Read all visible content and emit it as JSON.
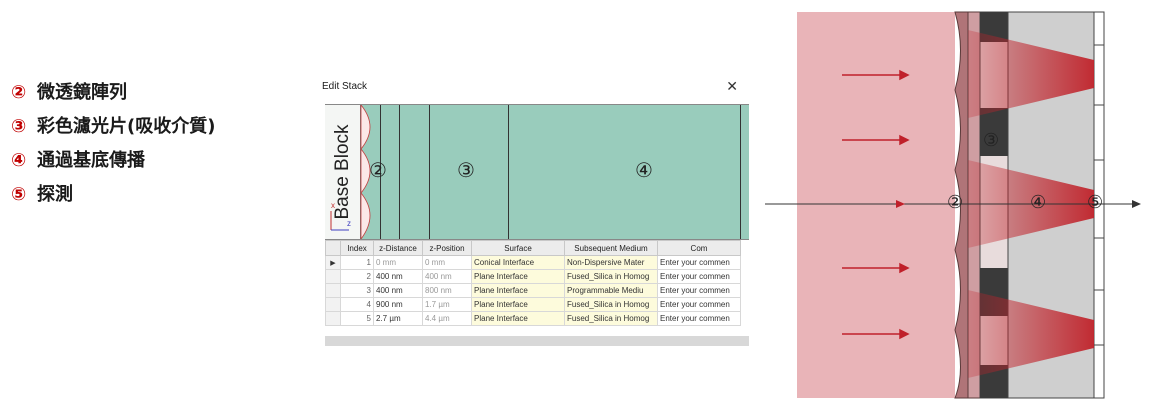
{
  "legend": [
    {
      "num": "②",
      "text": "微透鏡陣列"
    },
    {
      "num": "③",
      "text": "彩色濾光片(吸收介質)"
    },
    {
      "num": "④",
      "text": "通過基底傳播"
    },
    {
      "num": "⑤",
      "text": "探測"
    }
  ],
  "window": {
    "title": "Edit Stack",
    "close": "✕",
    "base_block": "Base Block",
    "axis_x": "x",
    "axis_z": "z",
    "region_labels": [
      "②",
      "③",
      "④"
    ]
  },
  "table": {
    "headers": [
      "",
      "Index",
      "z-Distance",
      "z-Position",
      "Surface",
      "Subsequent Medium",
      "Com"
    ],
    "rows": [
      {
        "sel": "▶",
        "index": "1",
        "zdist": "0 mm",
        "zpos": "0 mm",
        "surface": "Conical Interface",
        "medium": "Non-Dispersive Mater",
        "comment": "Enter your commen"
      },
      {
        "sel": "",
        "index": "2",
        "zdist": "400 nm",
        "zpos": "400 nm",
        "surface": "Plane Interface",
        "medium": "Fused_Silica in Homog",
        "comment": "Enter your commen"
      },
      {
        "sel": "",
        "index": "3",
        "zdist": "400 nm",
        "zpos": "800 nm",
        "surface": "Plane Interface",
        "medium": "Programmable Mediu",
        "comment": "Enter your commen"
      },
      {
        "sel": "",
        "index": "4",
        "zdist": "900 nm",
        "zpos": "1.7 µm",
        "surface": "Plane Interface",
        "medium": "Fused_Silica in Homog",
        "comment": "Enter your commen"
      },
      {
        "sel": "",
        "index": "5",
        "zdist": "2.7 µm",
        "zpos": "4.4 µm",
        "surface": "Plane Interface",
        "medium": "Fused_Silica in Homog",
        "comment": "Enter your commen"
      }
    ]
  },
  "diagram": {
    "labels": [
      "②",
      "③",
      "④",
      "⑤"
    ],
    "colors": {
      "incident": "#e9b4b8",
      "arrow": "#c0202a",
      "cone": "#c0222a",
      "filter": "#3a3a3a",
      "substrate": "#cfcfcf"
    }
  }
}
